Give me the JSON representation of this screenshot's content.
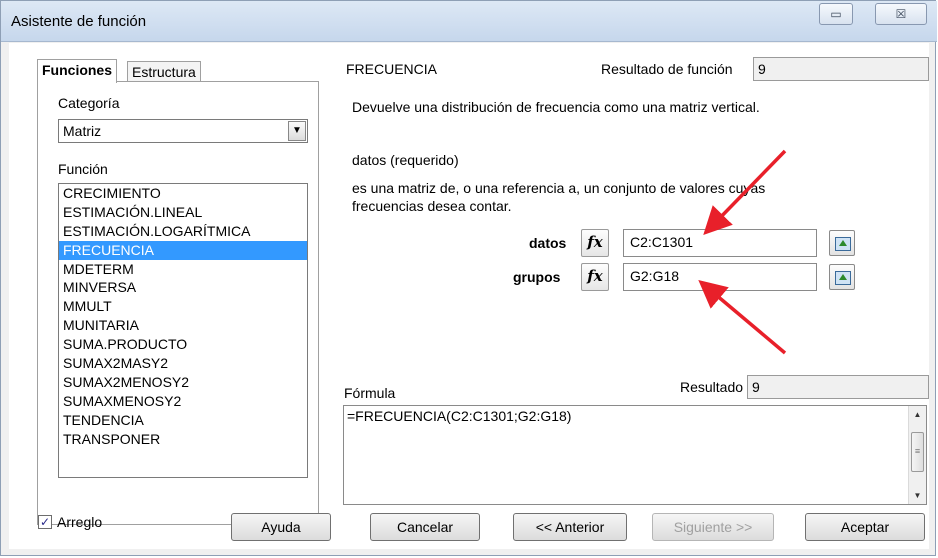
{
  "window": {
    "title": "Asistente de función",
    "restore_glyph": "▭",
    "close_glyph": "☒"
  },
  "tabs": [
    {
      "label": "Funciones"
    },
    {
      "label": "Estructura"
    }
  ],
  "sidebar": {
    "category_label": "Categoría",
    "category_value": "Matriz",
    "function_label": "Función",
    "functions": [
      "CRECIMIENTO",
      "ESTIMACIÓN.LINEAL",
      "ESTIMACIÓN.LOGARÍTMICA",
      "FRECUENCIA",
      "MDETERM",
      "MINVERSA",
      "MMULT",
      "MUNITARIA",
      "SUMA.PRODUCTO",
      "SUMAX2MASY2",
      "SUMAX2MENOSY2",
      "SUMAXMENOSY2",
      "TENDENCIA",
      "TRANSPONER"
    ],
    "selected_function": "FRECUENCIA"
  },
  "detail": {
    "function_name": "FRECUENCIA",
    "result_label": "Resultado de función",
    "result_value": "9",
    "description": "Devuelve una distribución de frecuencia como una matriz vertical.",
    "param_title": "datos (requerido)",
    "param_description_line1": "es una matriz de, o una referencia a, un conjunto de valores cuyas",
    "param_description_line2": "frecuencias desea contar.",
    "params": [
      {
        "label": "datos",
        "value": "C2:C1301"
      },
      {
        "label": "grupos",
        "value": "G2:G18"
      }
    ],
    "fx_glyph": "fx"
  },
  "formula": {
    "label": "Fórmula",
    "result_label": "Resultado",
    "result_value": "9",
    "text": "=FRECUENCIA(C2:C1301;G2:G18)"
  },
  "footer": {
    "array_label": "Arreglo",
    "array_checked": true,
    "check_glyph": "✓",
    "help": "Ayuda",
    "cancel": "Cancelar",
    "back": "<< Anterior",
    "next": "Siguiente >>",
    "ok": "Aceptar"
  },
  "colors": {
    "selection": "#3399ff",
    "arrow": "#e8202a"
  }
}
